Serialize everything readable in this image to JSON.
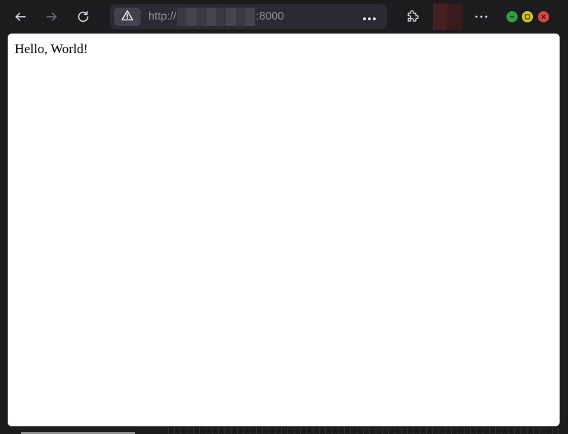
{
  "toolbar": {
    "back_icon": "arrow-left-icon",
    "forward_icon": "arrow-right-icon",
    "reload_icon": "reload-icon",
    "url_prefix": "http://",
    "url_suffix": ":8000",
    "site_info_icon": "warning-icon",
    "page_actions_icon": "more-horizontal-icon",
    "extensions_icon": "puzzle-icon",
    "menu_icon": "more-horizontal-icon"
  },
  "window_controls": {
    "minimize_color": "#2ea043",
    "maximize_color": "#d4c529",
    "close_color": "#d64545"
  },
  "page": {
    "body_text": "Hello, World!"
  },
  "colors": {
    "chrome_bg": "#1c1c1e",
    "urlbar_bg": "#2b2a33",
    "url_text": "#8f8f9d",
    "content_bg": "#ffffff"
  }
}
